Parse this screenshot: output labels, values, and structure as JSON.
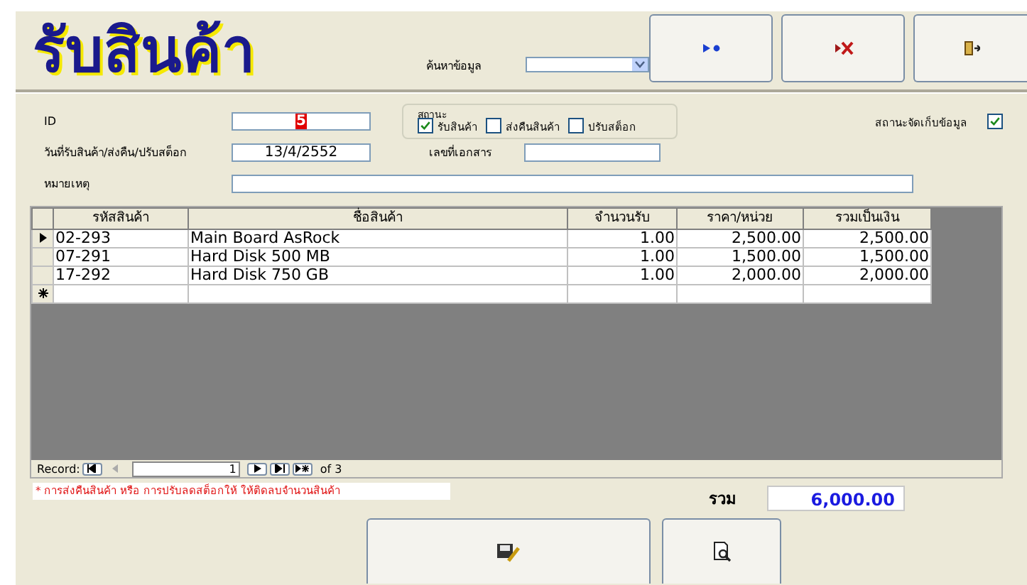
{
  "title": "รับสินค้า",
  "search": {
    "label": "ค้นหาข้อมูล"
  },
  "toolbar_buttons": [
    {
      "kind": "add"
    },
    {
      "kind": "delete"
    },
    {
      "kind": "exit"
    }
  ],
  "fields": {
    "id": {
      "label": "ID",
      "value": "5"
    },
    "status": {
      "label": "สถานะ",
      "options": [
        {
          "label": "รับสินค้า",
          "checked": true
        },
        {
          "label": "ส่งคืนสินค้า",
          "checked": false
        },
        {
          "label": "ปรับสต็อก",
          "checked": false
        }
      ]
    },
    "storage": {
      "label": "สถานะจัดเก็บข้อมูล",
      "checked": true
    },
    "date": {
      "label": "วันที่รับสินค้า/ส่งคืน/ปรับสต็อก",
      "value": "13/4/2552"
    },
    "doc_no": {
      "label": "เลขที่เอกสาร"
    },
    "remark": {
      "label": "หมายเหตุ"
    }
  },
  "grid": {
    "columns": [
      "รหัสสินค้า",
      "ชื่อสินค้า",
      "จำนวนรับ",
      "ราคา/หน่วย",
      "รวมเป็นเงิน"
    ],
    "rows": [
      {
        "selected": true,
        "cells": [
          "02-293",
          "Main Board AsRock",
          "1.00",
          "2,500.00",
          "2,500.00"
        ]
      },
      {
        "selected": false,
        "cells": [
          "07-291",
          "Hard Disk 500 MB",
          "1.00",
          "1,500.00",
          "1,500.00"
        ]
      },
      {
        "selected": false,
        "cells": [
          "17-292",
          "Hard Disk 750 GB",
          "1.00",
          "2,000.00",
          "2,000.00"
        ]
      }
    ],
    "navigator": {
      "label": "Record:",
      "current": "1",
      "total": "of 3"
    }
  },
  "note": "* การส่งคืนสินค้า  หรือ การปรับลดสต็อกให้ ให้ติดลบจำนวนสินค้า",
  "total": {
    "label": "รวม",
    "value": "6,000.00"
  },
  "bottom_buttons": [
    {
      "kind": "save"
    },
    {
      "kind": "preview"
    }
  ]
}
